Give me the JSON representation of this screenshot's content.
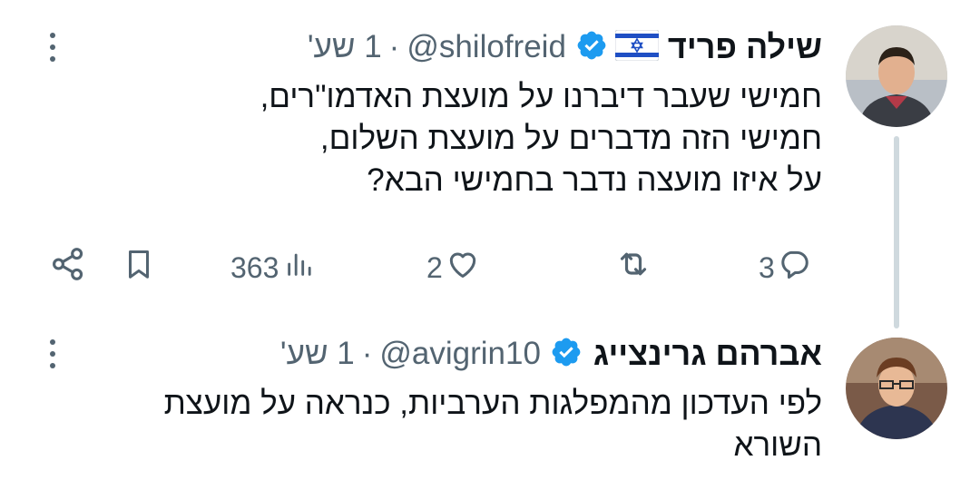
{
  "tweet": {
    "author_name": "שילה פריד",
    "flag_icon": "israel-flag-icon",
    "handle": "@shilofreid",
    "separator": "·",
    "time": "1 שע'",
    "lines": [
      "חמישי שעבר דיברנו על מועצת האדמו\"רים,",
      "חמישי הזה מדברים על מועצת השלום,",
      "על איזו מועצה נדבר בחמישי הבא?"
    ],
    "actions": {
      "reply_count": "3",
      "like_count": "2",
      "views_count": "363"
    }
  },
  "reply": {
    "author_name": "אברהם גרינצייג",
    "handle": "@avigrin10",
    "separator": "·",
    "time": "1 שע'",
    "lines": [
      "לפי העדכון מהמפלגות הערביות, כנראה על מועצת",
      "השורא"
    ]
  },
  "colors": {
    "text": "#0f1419",
    "secondary": "#536471",
    "verified": "#1d9bf0",
    "thread_line": "#cfd9de"
  }
}
